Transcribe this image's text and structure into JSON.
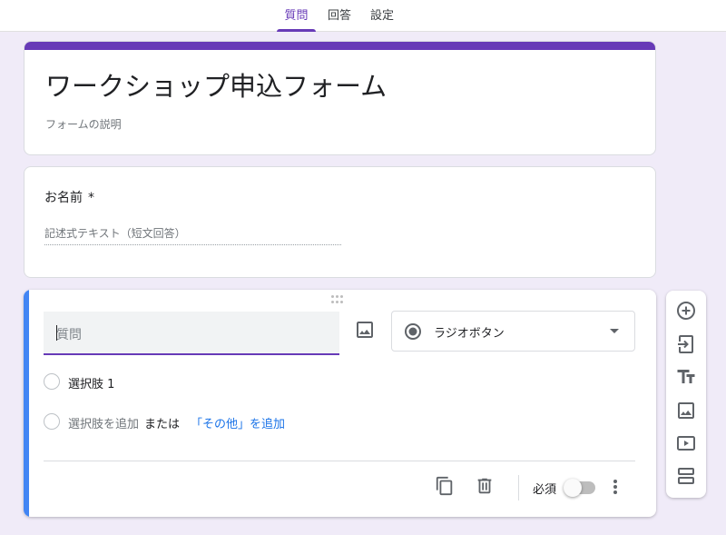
{
  "tabs": [
    {
      "label": "質問",
      "active": true
    },
    {
      "label": "回答",
      "active": false
    },
    {
      "label": "設定",
      "active": false
    }
  ],
  "form": {
    "title": "ワークショップ申込フォーム",
    "description_placeholder": "フォームの説明"
  },
  "name_question": {
    "title": "お名前",
    "required_mark": "*",
    "answer_placeholder": "記述式テキスト（短文回答）"
  },
  "edit_question": {
    "title_placeholder": "質問",
    "type_label": "ラジオボタン",
    "option1": "選択肢 1",
    "add_option": "選択肢を追加",
    "or_text": "または",
    "add_other": "「その他」を追加",
    "required_label": "必須",
    "required_on": false
  },
  "side_toolbar": [
    "add-question-icon",
    "import-questions-icon",
    "add-title-icon",
    "add-image-icon",
    "add-video-icon",
    "add-section-icon"
  ],
  "colors": {
    "accent": "#673ab7",
    "focus_bar": "#4285f4",
    "link": "#1a73e8",
    "background": "#f0ebf8"
  }
}
